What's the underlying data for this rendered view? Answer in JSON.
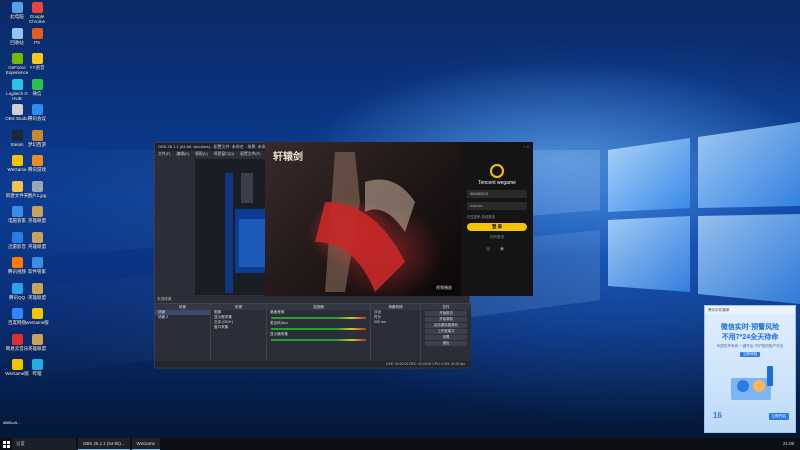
{
  "desktop": {
    "icons": [
      {
        "label": "此电脑",
        "icon": "computer-icon",
        "color": "#5aa0e6"
      },
      {
        "label": "Google Chrome",
        "icon": "chrome-icon",
        "color": "#e8453c"
      },
      {
        "label": "回收站",
        "icon": "recycle-bin-icon",
        "color": "#8fc6f5"
      },
      {
        "label": "PS",
        "icon": "photoshop-icon",
        "color": "#e35b1d"
      },
      {
        "label": "GeForce Experience",
        "icon": "geforce-icon",
        "color": "#76b900"
      },
      {
        "label": "YY语音",
        "icon": "yy-icon",
        "color": "#f7c81c"
      },
      {
        "label": "Logitech G HUB",
        "icon": "logitech-icon",
        "color": "#27c3e8"
      },
      {
        "label": "微信",
        "icon": "wechat-icon",
        "color": "#2ac24c"
      },
      {
        "label": "OBS Studio",
        "icon": "obs-icon",
        "color": "#cfcfcf"
      },
      {
        "label": "腾讯会议",
        "icon": "tencent-meeting-icon",
        "color": "#2d8cf0"
      },
      {
        "label": "Steam",
        "icon": "steam-icon",
        "color": "#1b2838"
      },
      {
        "label": "梦幻西游",
        "icon": "game-icon",
        "color": "#c98a2e"
      },
      {
        "label": "WeGame",
        "icon": "wegame-icon",
        "color": "#f5c400"
      },
      {
        "label": "腾讯游戏",
        "icon": "tencent-game-icon",
        "color": "#f08a24"
      },
      {
        "label": "新建文件夹",
        "icon": "folder-icon",
        "color": "#f2c14e"
      },
      {
        "label": "图片1.jpg",
        "icon": "image-icon",
        "color": "#9aa6b2"
      },
      {
        "label": "电脑管家",
        "icon": "pc-manager-icon",
        "color": "#3a8ee6"
      },
      {
        "label": "英雄联盟",
        "icon": "lol-icon",
        "color": "#c9a35a"
      },
      {
        "label": "迅雷影音",
        "icon": "xunlei-icon",
        "color": "#2c7be5"
      },
      {
        "label": "英雄联盟",
        "icon": "lol-icon",
        "color": "#c9a35a"
      },
      {
        "label": "腾讯视频",
        "icon": "tencent-video-icon",
        "color": "#ff7a00"
      },
      {
        "label": "软件管家",
        "icon": "software-store-icon",
        "color": "#3a8ee6"
      },
      {
        "label": "腾讯QQ",
        "icon": "qq-icon",
        "color": "#2aa1e8"
      },
      {
        "label": "英雄联盟",
        "icon": "lol-icon",
        "color": "#c9a35a"
      },
      {
        "label": "百度网盘",
        "icon": "baidu-pan-icon",
        "color": "#2f86ff"
      },
      {
        "label": "WeGame版",
        "icon": "wegame-icon",
        "color": "#f5c400"
      },
      {
        "label": "网易云音乐",
        "icon": "netease-music-icon",
        "color": "#e02d2d"
      },
      {
        "label": "英雄联盟",
        "icon": "lol-icon",
        "color": "#c9a35a"
      },
      {
        "label": "WeGame版",
        "icon": "wegame-icon",
        "color": "#f5c400"
      },
      {
        "label": "哔哩",
        "icon": "bilibili-icon",
        "color": "#23ade5"
      }
    ],
    "corner_note": "8885cuf1..."
  },
  "obs": {
    "title": "OBS 26.1.1 (64-bit, windows) - 配置文件: 未命名 - 场景: 未命名",
    "menu": [
      "文件(F)",
      "编辑(E)",
      "视图(V)",
      "停靠窗口(D)",
      "配置文件(P)",
      "场景集合(S)",
      "工具(T)",
      "帮助(H)"
    ],
    "scene_label": "未选择源",
    "docks": {
      "scenes": {
        "title": "场景",
        "items": [
          "场景",
          "场景 2"
        ]
      },
      "sources": {
        "title": "来源",
        "items": [
          "图像",
          "显示器采集",
          "文本 (GDI+)",
          "窗口采集"
        ]
      },
      "mixer": {
        "title": "混音器",
        "tracks": [
          "桌面音频",
          "麦克风/Aux",
          "显示器采集"
        ]
      },
      "transitions": {
        "title": "场景转换",
        "type": "淡出",
        "duration_label": "时长",
        "duration": "300 ms"
      },
      "controls": {
        "title": "控件",
        "buttons": [
          "开始推流",
          "开始录制",
          "启动虚拟摄像机",
          "工作室模式",
          "设置",
          "退出"
        ]
      }
    },
    "status": "LIVE: 00:00:00   REC: 00:00:00   CPU: 0.4%, 30.00 fps"
  },
  "game": {
    "title": "轩辕剑",
    "tag": "视频播放",
    "login": {
      "top_controls": "− ×",
      "brand": "Tencent wegame",
      "account": "564483210",
      "password": "••••••••••",
      "remember": "记住密码   自动登录",
      "button": "登 录",
      "qr": "扫码登录",
      "alt": "◎ ◉"
    }
  },
  "ad": {
    "header": "腾讯手机管家",
    "title1": "微信实时·预警风险",
    "title2": "不用7*24全天待命",
    "subtitle": "专属防护系统 一键开启 守护您的账户安全",
    "tag": "立即体验",
    "number": "16",
    "cta": "立即开启"
  },
  "taskbar": {
    "search": "设置",
    "items": [
      "OBS 26.1.1 (64-bit)...",
      "WeGame"
    ],
    "clock": "21:08"
  }
}
